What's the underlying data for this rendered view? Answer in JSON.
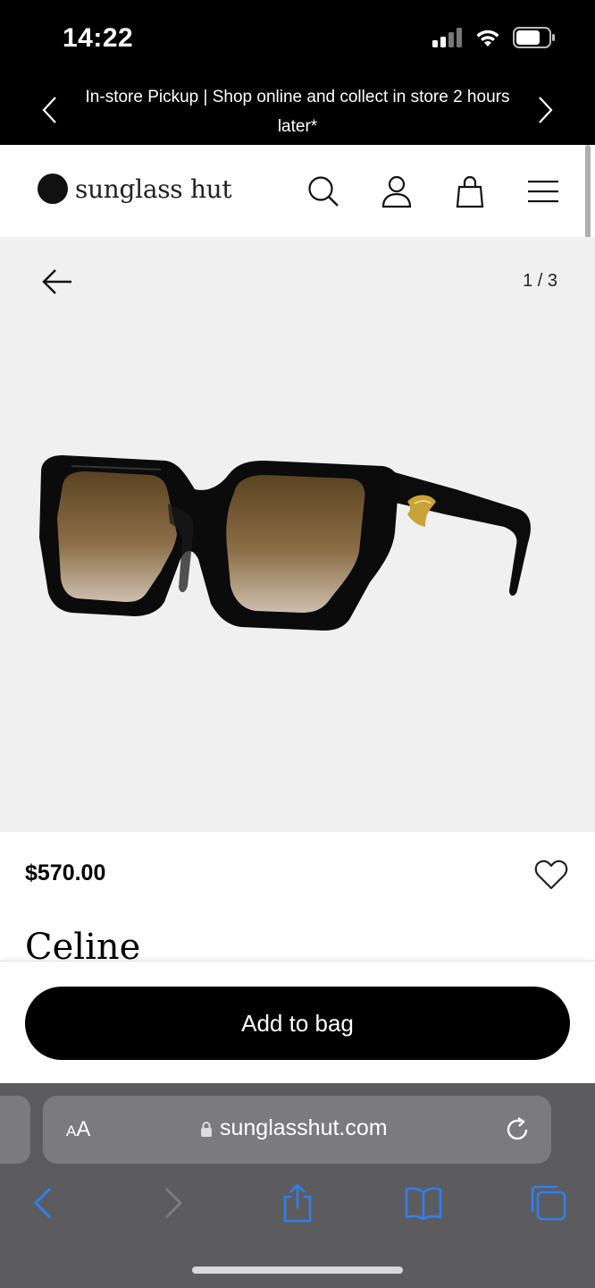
{
  "status_bar": {
    "time": "14:22"
  },
  "promo": {
    "text": "In-store Pickup | Shop online and collect in store 2 hours later*"
  },
  "header": {
    "logo_text": "sunglass hut"
  },
  "gallery": {
    "counter": "1 / 3"
  },
  "product": {
    "price": "$570.00",
    "brand": "Celine"
  },
  "cta": {
    "add_to_bag": "Add to bag"
  },
  "browser": {
    "text_size_label_big": "A",
    "text_size_label_small": "A",
    "url": "sunglasshut.com"
  },
  "colors": {
    "accent_blue": "#2f7ff0",
    "toolbar_bg": "#5c5c5f",
    "button_bg": "#000000"
  }
}
